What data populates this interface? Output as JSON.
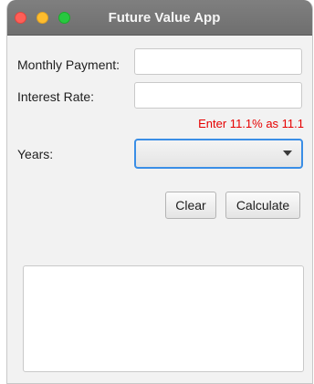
{
  "window": {
    "title": "Future Value App"
  },
  "form": {
    "monthly_payment_label": "Monthly Payment:",
    "monthly_payment_value": "",
    "interest_rate_label": "Interest Rate:",
    "interest_rate_value": "",
    "interest_rate_hint": "Enter 11.1% as 11.1",
    "years_label": "Years:",
    "years_value": ""
  },
  "buttons": {
    "clear_label": "Clear",
    "calculate_label": "Calculate"
  },
  "output": {
    "text": ""
  },
  "colors": {
    "hint": "#e60000",
    "focus": "#3a8ee6",
    "close": "#ff5f57",
    "minimize": "#febc2e",
    "maximize": "#28c840"
  }
}
